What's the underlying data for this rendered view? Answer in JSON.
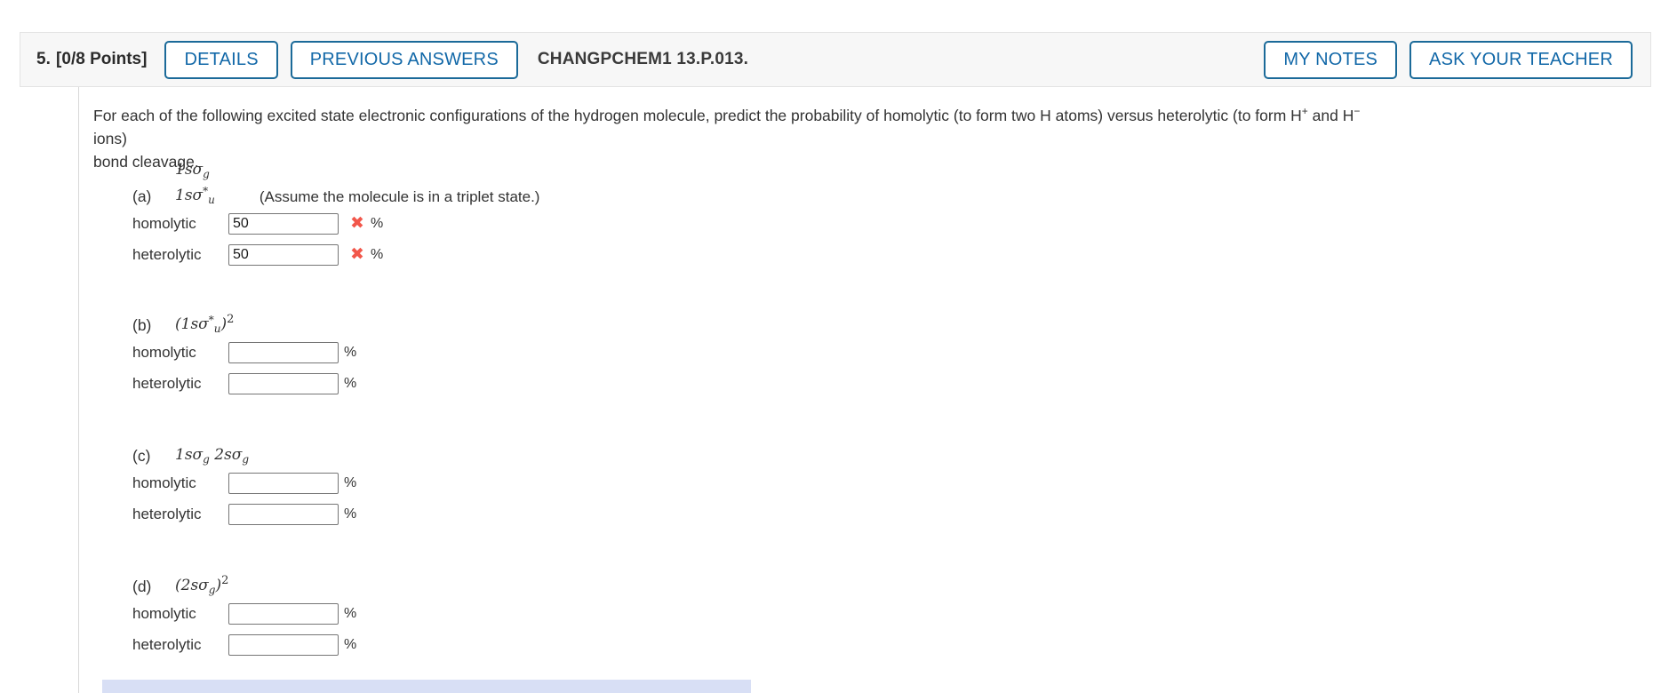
{
  "header": {
    "question_number": "5.",
    "points": "[0/8 Points]",
    "details_button": "DETAILS",
    "previous_answers_button": "PREVIOUS ANSWERS",
    "question_code": "CHANGPCHEM1 13.P.013.",
    "my_notes_button": "MY NOTES",
    "ask_your_teacher_button": "ASK YOUR TEACHER",
    "accent_color": "#1268a8",
    "border_color": "#1b6a99",
    "background_color": "#f7f7f7"
  },
  "prompt": {
    "line1_a": "For each of the following excited state electronic configurations of the hydrogen molecule, predict the probability of homolytic (to form two H atoms) versus heterolytic (to form H",
    "sup_plus": "+",
    "line1_b": " and H",
    "sup_minus": "−",
    "line1_c": " ions)",
    "line2": "bond cleavage."
  },
  "parts": [
    {
      "letter": "(a)",
      "config_stacked_top": "1sσ",
      "config_stacked_top_sub": "g",
      "config_main": "1sσ",
      "config_main_sup": "*",
      "config_main_sub": "u",
      "note": "(Assume the molecule is in a triplet state.)",
      "rows": [
        {
          "label": "homolytic",
          "value": "50",
          "mark": "✖",
          "unit": "%"
        },
        {
          "label": "heterolytic",
          "value": "50",
          "mark": "✖",
          "unit": "%"
        }
      ]
    },
    {
      "letter": "(b)",
      "config_prefix": "(1sσ",
      "config_sup": "*",
      "config_sub": "u",
      "config_suffix": ")",
      "config_exponent": "2",
      "rows": [
        {
          "label": "homolytic",
          "value": "",
          "mark": "",
          "unit": "%"
        },
        {
          "label": "heterolytic",
          "value": "",
          "mark": "",
          "unit": "%"
        }
      ]
    },
    {
      "letter": "(c)",
      "config_first": "1sσ",
      "config_first_sub": "g",
      "config_second": "2sσ",
      "config_second_sub": "g",
      "rows": [
        {
          "label": "homolytic",
          "value": "",
          "mark": "",
          "unit": "%"
        },
        {
          "label": "heterolytic",
          "value": "",
          "mark": "",
          "unit": "%"
        }
      ]
    },
    {
      "letter": "(d)",
      "config_prefix": "(2sσ",
      "config_sub": "g",
      "config_suffix": ")",
      "config_exponent": "2",
      "rows": [
        {
          "label": "homolytic",
          "value": "",
          "mark": "",
          "unit": "%"
        },
        {
          "label": "heterolytic",
          "value": "",
          "mark": "",
          "unit": "%"
        }
      ]
    }
  ],
  "colors": {
    "wrong_mark": "#f2574b",
    "bottom_bar": "#d8dff5"
  }
}
